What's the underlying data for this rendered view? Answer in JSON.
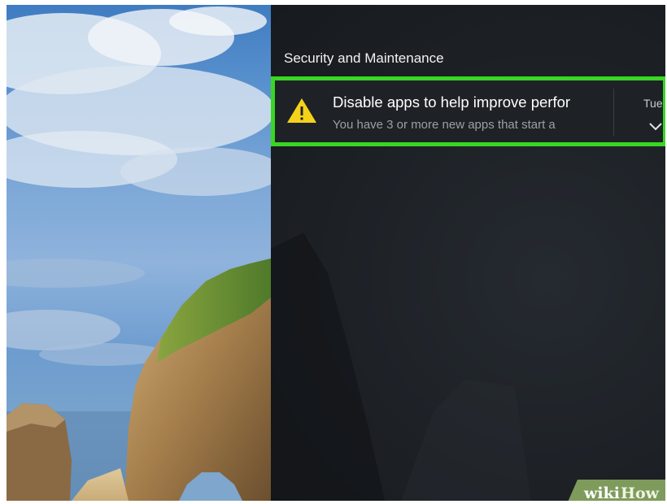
{
  "action_center": {
    "group_title": "Security and Maintenance",
    "notification": {
      "icon": "warning-icon",
      "title": "Disable apps to help improve perfor",
      "body": "You have 3 or more new apps that start a",
      "time": "Tue",
      "expand_icon": "chevron-down-icon"
    },
    "highlight_color": "#39d623"
  },
  "watermark": {
    "wiki": "wiki",
    "how": "How"
  }
}
